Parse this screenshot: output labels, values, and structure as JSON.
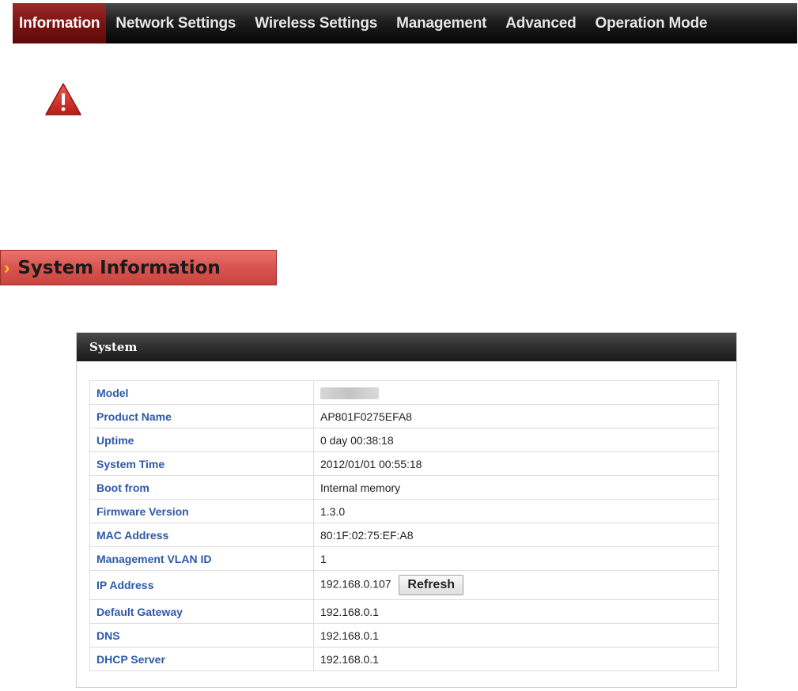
{
  "nav": {
    "items": [
      {
        "label": "Information",
        "active": true
      },
      {
        "label": "Network Settings",
        "active": false
      },
      {
        "label": "Wireless Settings",
        "active": false
      },
      {
        "label": "Management",
        "active": false
      },
      {
        "label": "Advanced",
        "active": false
      },
      {
        "label": "Operation Mode",
        "active": false
      }
    ]
  },
  "section": {
    "title": "System Information"
  },
  "panel": {
    "title": "System",
    "rows": [
      {
        "label": "Model",
        "value": ""
      },
      {
        "label": "Product Name",
        "value": "AP801F0275EFA8"
      },
      {
        "label": "Uptime",
        "value": "0 day 00:38:18"
      },
      {
        "label": "System Time",
        "value": "2012/01/01 00:55:18"
      },
      {
        "label": "Boot from",
        "value": "Internal memory"
      },
      {
        "label": "Firmware Version",
        "value": "1.3.0"
      },
      {
        "label": "MAC Address",
        "value": "80:1F:02:75:EF:A8"
      },
      {
        "label": "Management VLAN ID",
        "value": "1"
      },
      {
        "label": "IP Address",
        "value": "192.168.0.107"
      },
      {
        "label": "Default Gateway",
        "value": "192.168.0.1"
      },
      {
        "label": "DNS",
        "value": "192.168.0.1"
      },
      {
        "label": "DHCP Server",
        "value": "192.168.0.1"
      }
    ],
    "refresh_label": "Refresh"
  },
  "icons": {
    "warning": "warning-icon",
    "chevron": "chevron-right-icon"
  },
  "colors": {
    "nav_active": "#7a1212",
    "section_header": "#d9534f",
    "label_text": "#2d58a8",
    "chevron": "#f5c518"
  }
}
